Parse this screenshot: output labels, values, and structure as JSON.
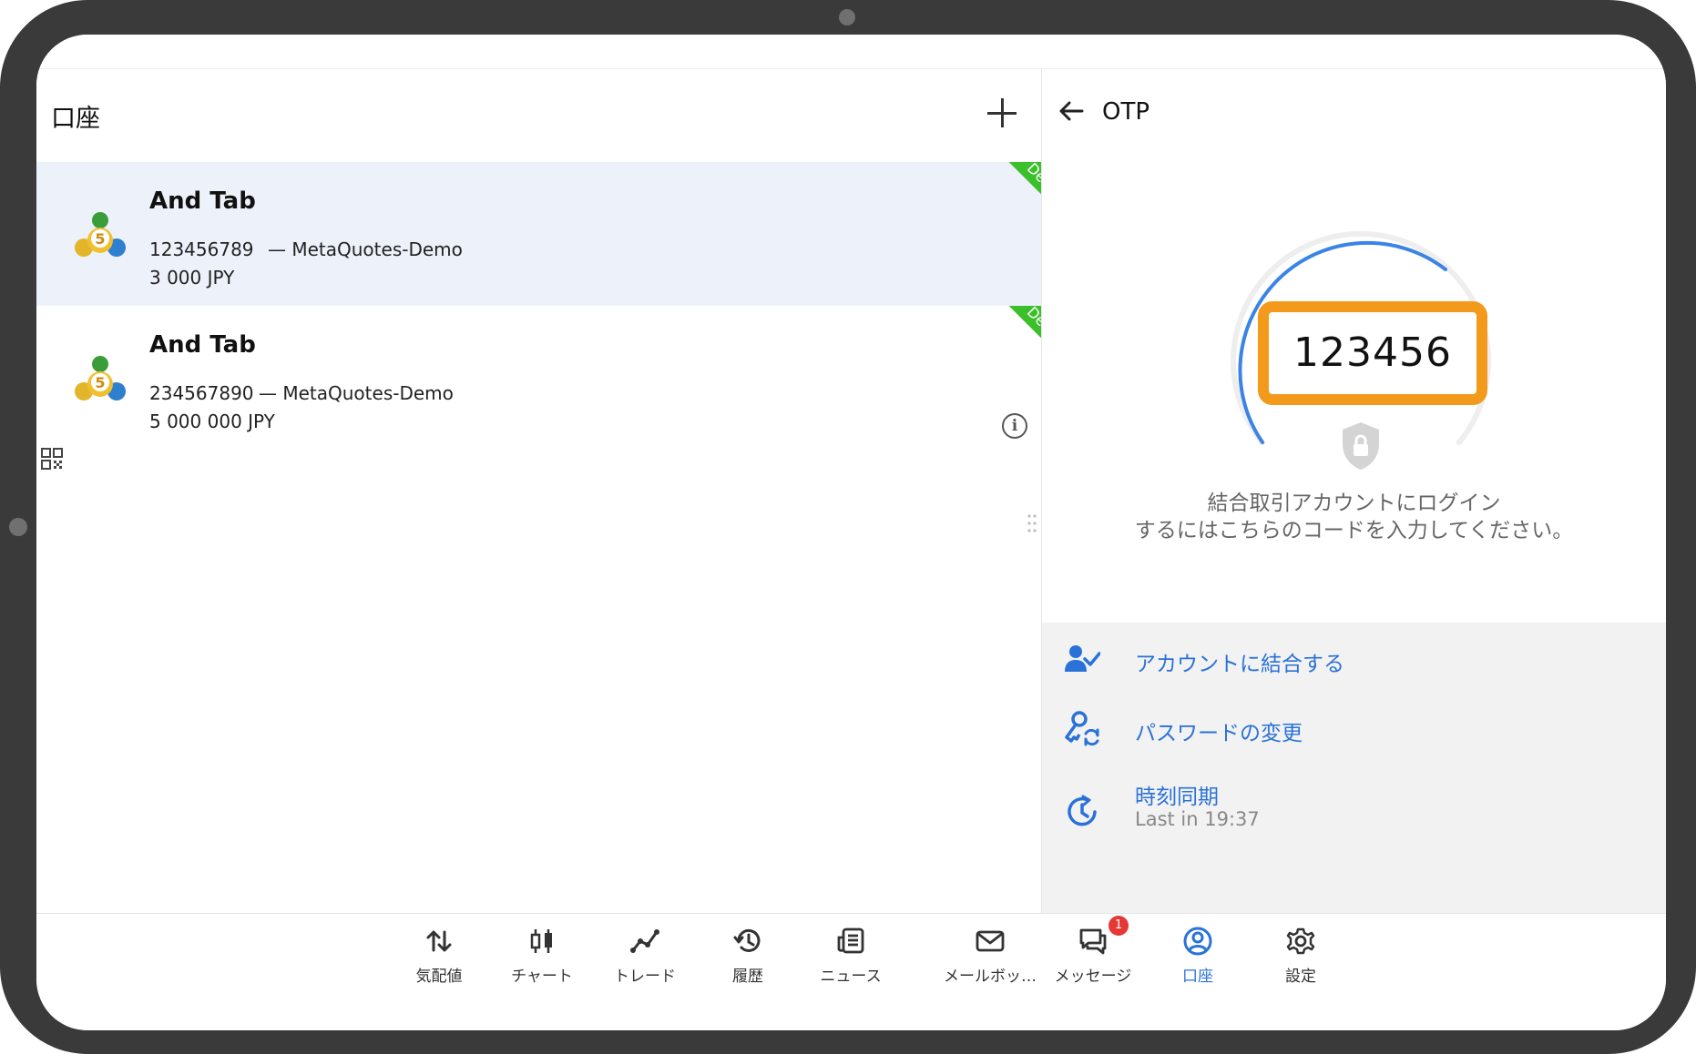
{
  "left_pane": {
    "title": "口座",
    "accounts": [
      {
        "name": "And Tab",
        "login": "123456789",
        "server": "— MetaQuotes-Demo",
        "balance": "3 000 JPY",
        "badge": "Demo",
        "selected": true
      },
      {
        "name": "And Tab",
        "login": "234567890",
        "server": "— MetaQuotes-Demo",
        "balance": "5 000 000 JPY",
        "badge": "Demo",
        "selected": false
      }
    ]
  },
  "right_pane": {
    "title": "OTP",
    "otp_code": "123456",
    "description_line1": "結合取引アカウントにログイン",
    "description_line2": "するにはこちらのコードを入力してください。",
    "actions": [
      {
        "label": "アカウントに結合する",
        "icon": "user-link-icon"
      },
      {
        "label": "パスワードの変更",
        "icon": "password-change-icon"
      },
      {
        "label": "時刻同期",
        "sublabel": "Last in 19:37",
        "icon": "time-sync-icon"
      }
    ]
  },
  "bottom_nav": {
    "items": [
      {
        "label": "気配値",
        "icon": "quotes-icon"
      },
      {
        "label": "チャート",
        "icon": "chart-icon"
      },
      {
        "label": "トレード",
        "icon": "trade-icon"
      },
      {
        "label": "履歴",
        "icon": "history-icon"
      },
      {
        "label": "ニュース",
        "icon": "news-icon"
      },
      {
        "label": "メールボッ…",
        "icon": "mailbox-icon"
      },
      {
        "label": "メッセージ",
        "icon": "messages-icon",
        "badge": "1"
      },
      {
        "label": "口座",
        "icon": "accounts-icon",
        "active": true
      },
      {
        "label": "設定",
        "icon": "settings-icon"
      }
    ]
  },
  "colors": {
    "accent": "#2a72d8",
    "otp_border": "#f39a1c",
    "demo_ribbon": "#3bbf2a",
    "selected_row": "#edf2fa",
    "badge": "#e53935"
  }
}
